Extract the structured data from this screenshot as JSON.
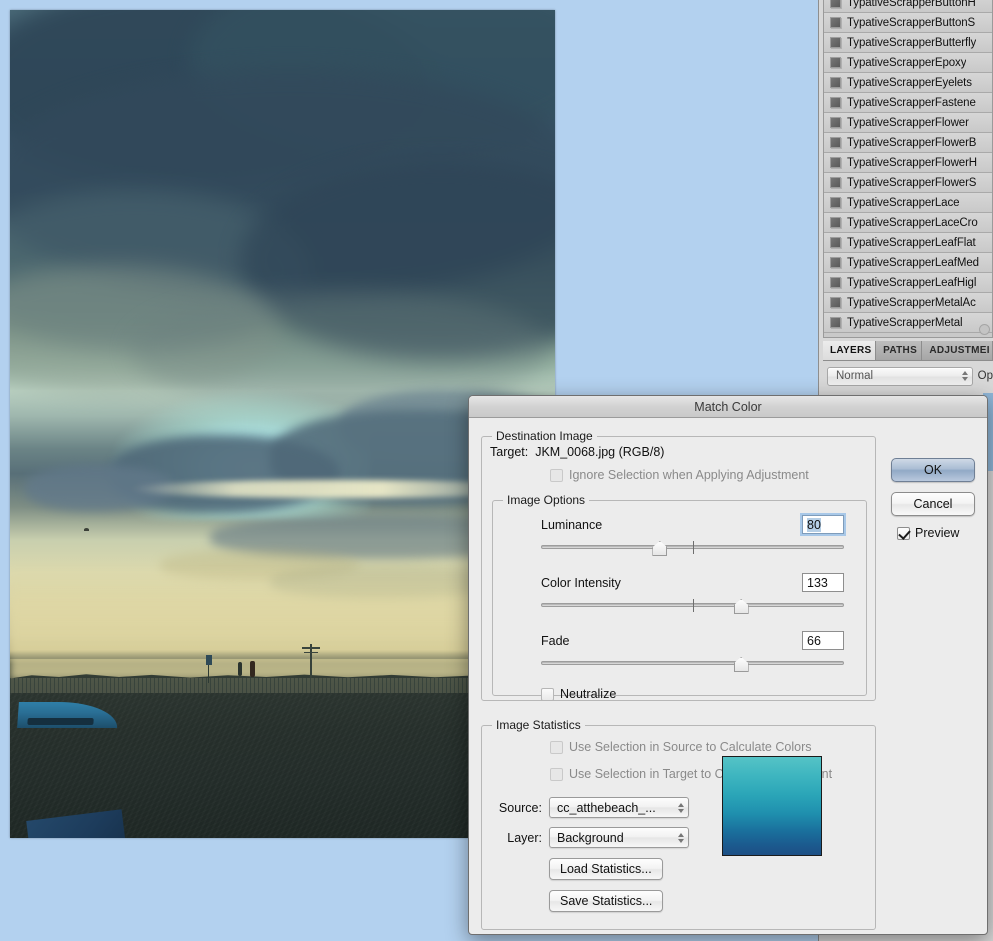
{
  "desktop": {
    "background_color": "#b3d1ef"
  },
  "document_window": {
    "name": "photo-canvas",
    "description": "Beach sunset photograph with clouds, dunes, fence, boat"
  },
  "styles_panel": {
    "items": [
      "TypativeScrapperButtonH",
      "TypativeScrapperButtonS",
      "TypativeScrapperButterfly",
      "TypativeScrapperEpoxy",
      "TypativeScrapperEyelets",
      "TypativeScrapperFastene",
      "TypativeScrapperFlower",
      "TypativeScrapperFlowerB",
      "TypativeScrapperFlowerH",
      "TypativeScrapperFlowerS",
      "TypativeScrapperLace",
      "TypativeScrapperLaceCro",
      "TypativeScrapperLeafFlat",
      "TypativeScrapperLeafMed",
      "TypativeScrapperLeafHigl",
      "TypativeScrapperMetalAc",
      "TypativeScrapperMetal"
    ]
  },
  "layers_panel": {
    "tabs": [
      {
        "label": "LAYERS",
        "active": true
      },
      {
        "label": "PATHS",
        "active": false
      },
      {
        "label": "ADJUSTMEI",
        "active": false
      }
    ],
    "blend_mode": "Normal",
    "opacity_label": "Op"
  },
  "dialog": {
    "title": "Match Color",
    "destination_group": {
      "legend": "Destination Image",
      "target_label": "Target:",
      "target_value": "JKM_0068.jpg (RGB/8)",
      "ignore_selection": {
        "label": "Ignore Selection when Applying Adjustment",
        "checked": false,
        "enabled": false
      }
    },
    "image_options": {
      "legend": "Image Options",
      "sliders": [
        {
          "label": "Luminance",
          "value": "80",
          "percent": 38,
          "tick_percent": 50,
          "focused": true
        },
        {
          "label": "Color Intensity",
          "value": "133",
          "percent": 65,
          "tick_percent": 50,
          "focused": false
        },
        {
          "label": "Fade",
          "value": "66",
          "percent": 65,
          "tick_percent": null,
          "focused": false
        }
      ],
      "neutralize": {
        "label": "Neutralize",
        "checked": false
      }
    },
    "image_statistics": {
      "legend": "Image Statistics",
      "use_selection_source": {
        "label": "Use Selection in Source to Calculate Colors",
        "checked": false,
        "enabled": false
      },
      "use_selection_target": {
        "label": "Use Selection in Target to Calculate Adjustment",
        "checked": false,
        "enabled": false
      },
      "source_label": "Source:",
      "source_value": "cc_atthebeach_...",
      "layer_label": "Layer:",
      "layer_value": "Background",
      "load_button": "Load Statistics...",
      "save_button": "Save Statistics...",
      "preview_swatch_colors": [
        "#55c3c6",
        "#1d4f85"
      ]
    },
    "buttons": {
      "ok": "OK",
      "cancel": "Cancel",
      "preview": {
        "label": "Preview",
        "checked": true
      }
    }
  }
}
